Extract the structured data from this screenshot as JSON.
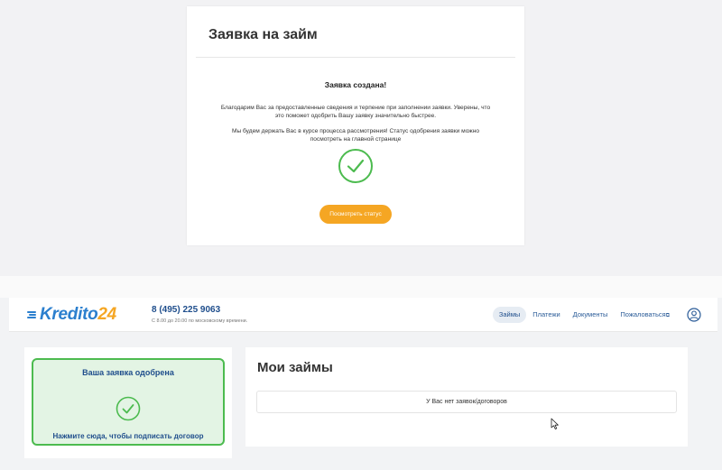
{
  "modal": {
    "title": "Заявка на займ",
    "heading": "Заявка создана!",
    "paragraph1": "Благодарим Вас за предоставленные сведения и терпение при заполнении заявки. Уверены, что это поможет одобрить Вашу заявку значительно быстрее.",
    "paragraph2": "Мы будем держать Вас в курсе процесса рассмотрения! Статус одобрения заявки можно посмотреть на главной странице",
    "button_label": "Посмотреть статус"
  },
  "header": {
    "logo_main": "Kredito",
    "logo_num": "24",
    "phone": "8 (495) 225 9063",
    "hours": "С 8.00 до 20.00 по московскому времени.",
    "nav": {
      "loans": "Займы",
      "payments": "Платежи",
      "documents": "Документы",
      "complain": "Пожаловаться"
    },
    "active_nav": "loans"
  },
  "approval_card": {
    "title": "Ваша заявка одобрена",
    "subtitle": "Нажмите сюда, чтобы подписать договор"
  },
  "loans_panel": {
    "title": "Мои займы",
    "empty_text": "У Вас нет заявок/договоров"
  },
  "icons": {
    "check": "check-circle-icon",
    "user": "user-circle-icon",
    "external": "external-link-icon"
  },
  "colors": {
    "brand_blue": "#2b7fce",
    "brand_orange": "#f5a623",
    "success_green": "#4cbb4f",
    "nav_text": "#2b5c98"
  }
}
